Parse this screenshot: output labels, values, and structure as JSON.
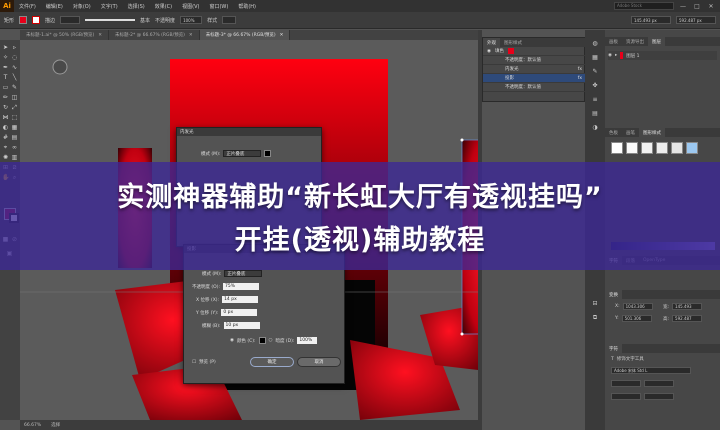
{
  "app": {
    "logo": "Ai",
    "window_buttons": [
      "—",
      "□",
      "✕"
    ],
    "search_placeholder": "Adobe Stock"
  },
  "menus": [
    "文件(F)",
    "编辑(E)",
    "对象(O)",
    "文字(T)",
    "选择(S)",
    "效果(C)",
    "视图(V)",
    "窗口(W)",
    "帮助(H)"
  ],
  "controlbar": {
    "object_label": "矩形",
    "stroke_label": "描边",
    "opacity_label": "不透明度",
    "opacity_value": "100%",
    "style_label": "样式",
    "basic_label": "基本",
    "width_value": "145.493 px",
    "height_value": "592.487 px"
  },
  "tabs": [
    {
      "label": "未标题-1.ai* @ 50% (RGB/预览)"
    },
    {
      "label": "未标题-2* @ 66.67% (RGB/预览)"
    },
    {
      "label": "未标题-3* @ 66.67% (RGB/预览)",
      "active": true
    }
  ],
  "status": {
    "zoom": "66.67%",
    "tool": "选择"
  },
  "inner_glow_dialog": {
    "title": "内发光",
    "mode_label": "模式 (M):",
    "mode_value": "正片叠底"
  },
  "shadow_dialog": {
    "title": "投影",
    "mode_label": "模式 (M):",
    "mode_value": "正片叠底",
    "opacity_label": "不透明度 (O):",
    "opacity_value": "75%",
    "x_label": "X 位移 (X):",
    "x_value": "14 px",
    "y_label": "Y 位移 (Y):",
    "y_value": "0 px",
    "blur_label": "模糊 (B):",
    "blur_value": "10 px",
    "color_label": "颜色 (C):",
    "darkness_label": "暗度 (D):",
    "darkness_value": "100%",
    "preview_label": "预览 (P)",
    "ok_label": "确定",
    "cancel_label": "取消"
  },
  "appearance_panel": {
    "tabs": [
      "外观",
      "图形样式"
    ],
    "rows": [
      "填色",
      "不透明度：默认值",
      "内发光",
      "投影",
      "不透明度：默认值"
    ]
  },
  "right_panels": {
    "top_tabs": [
      "画板",
      "资源导出",
      "图层"
    ],
    "layer_name": "图层 1",
    "swatch_tabs": [
      "色板",
      "画笔",
      "图形样式"
    ],
    "mid_tabs": [
      "字符",
      "段落",
      "OpenType"
    ],
    "transform_tab": "变换",
    "x_value": "1043.306",
    "y_value": "145.493",
    "w_value": "501.306",
    "h_value": "592.487",
    "type_tab": "字符",
    "font_label": "修饰文字工具",
    "font_value": "Adobe 宋体 Std L"
  },
  "banner": {
    "line1": "实测神器辅助“新长虹大厅有透视挂吗”",
    "line2": "开挂(透视)辅助教程"
  },
  "colors": {
    "accent_red": "#e8001a",
    "banner": "#3c2896"
  }
}
